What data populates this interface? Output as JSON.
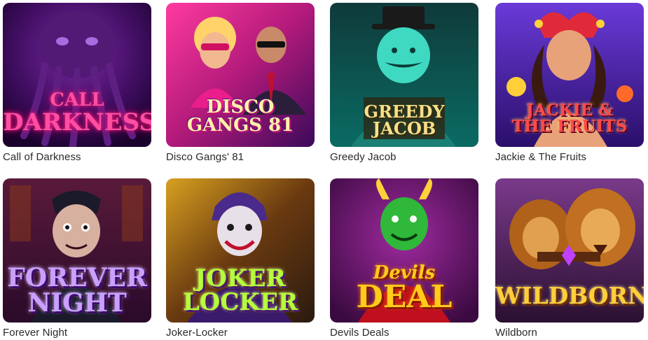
{
  "games": [
    {
      "title": "Call of Darkness",
      "logo_top": "CALL",
      "logo_bottom": "DARKNESS"
    },
    {
      "title": "Disco Gangs' 81",
      "logo_top": "DISCO",
      "logo_bottom": "GANGS 81"
    },
    {
      "title": "Greedy Jacob",
      "logo_top": "GREEDY",
      "logo_bottom": "JACOB"
    },
    {
      "title": "Jackie & The Fruits",
      "logo_top": "JACKIE &",
      "logo_bottom": "THE FRUITS"
    },
    {
      "title": "Forever Night",
      "logo_top": "FOREVER",
      "logo_bottom": "NIGHT"
    },
    {
      "title": "Joker-Locker",
      "logo_top": "JOKER",
      "logo_bottom": "LOCKER"
    },
    {
      "title": "Devils Deals",
      "logo_top": "Devils",
      "logo_bottom": "DEAL"
    },
    {
      "title": "Wildborn",
      "logo_top": "",
      "logo_bottom": "WILDBORN"
    }
  ]
}
